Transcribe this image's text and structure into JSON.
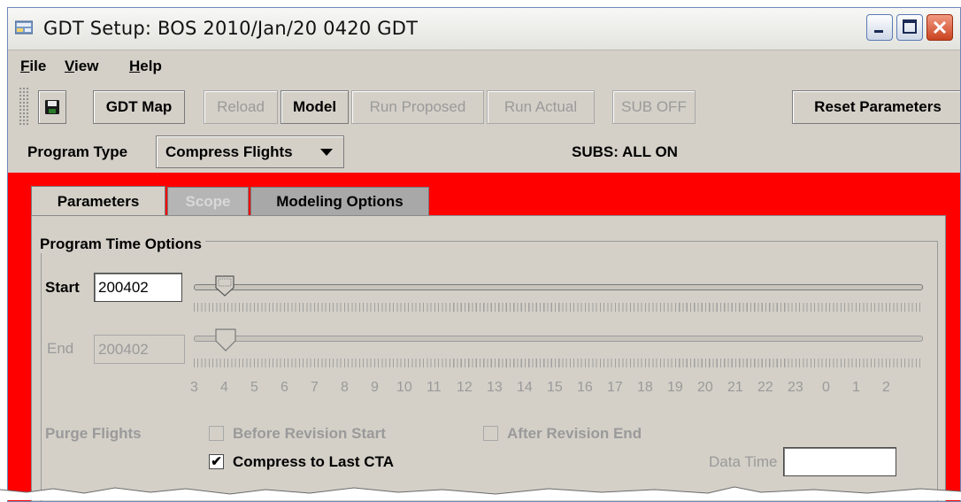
{
  "window": {
    "title": "GDT Setup: BOS 2010/Jan/20 0420 GDT",
    "title_icon": "app-icon",
    "controls": {
      "minimize": "minimize-icon",
      "maximize": "maximize-icon",
      "close": "close-icon"
    },
    "close_color": "#d9532c"
  },
  "menu": [
    {
      "accel": "F",
      "rest": "ile"
    },
    {
      "accel": "V",
      "rest": "iew"
    },
    {
      "accel": "H",
      "rest": "elp"
    }
  ],
  "toolbar": {
    "save_icon": "floppy-disk-icon",
    "gdt_map": "GDT Map",
    "reload": "Reload",
    "model": "Model",
    "run_proposed": "Run Proposed",
    "run_actual": "Run Actual",
    "sub_off": "SUB OFF",
    "reset_parameters": "Reset Parameters"
  },
  "program": {
    "type_label": "Program Type",
    "type_value": "Compress Flights",
    "subs_status": "SUBS: ALL ON"
  },
  "accent_color": "#ff0000",
  "tabs": [
    {
      "label": "Parameters",
      "state": "active"
    },
    {
      "label": "Scope",
      "state": "disabled"
    },
    {
      "label": "Modeling Options",
      "state": "inactive"
    }
  ],
  "time_options": {
    "group_title": "Program Time Options",
    "start_label": "Start",
    "start_value": "200402",
    "end_label": "End",
    "end_value": "200402",
    "hour_ticks": [
      "3",
      "4",
      "5",
      "6",
      "7",
      "8",
      "9",
      "10",
      "11",
      "12",
      "13",
      "14",
      "15",
      "16",
      "17",
      "18",
      "19",
      "20",
      "21",
      "22",
      "23",
      "0",
      "1",
      "2"
    ]
  },
  "purge": {
    "label": "Purge Flights",
    "before_revision_start": "Before Revision Start",
    "before_checked": false,
    "after_revision_end": "After Revision End",
    "after_checked": false
  },
  "compress": {
    "label": "Compress to Last CTA",
    "checked": true,
    "check_glyph": "✔"
  },
  "data_time": {
    "label": "Data Time",
    "value": ""
  }
}
